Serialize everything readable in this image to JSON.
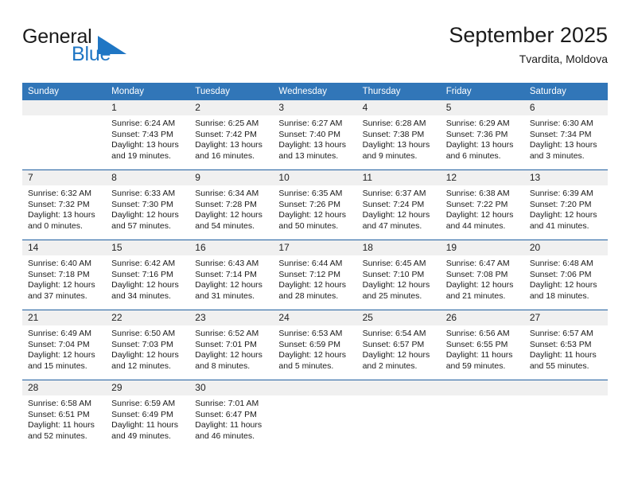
{
  "brand": {
    "name_part1": "General",
    "name_part2": "Blue",
    "accent_color": "#1f76c4",
    "triangle_icon": "triangle-icon"
  },
  "header": {
    "title": "September 2025",
    "subtitle": "Tvardita, Moldova"
  },
  "calendar": {
    "header_bg": "#3176b8",
    "daynum_bg": "#f0f0f0",
    "separator_color": "#1f5fa0",
    "weekdays": [
      "Sunday",
      "Monday",
      "Tuesday",
      "Wednesday",
      "Thursday",
      "Friday",
      "Saturday"
    ],
    "weeks": [
      [
        {
          "day": "",
          "lines": []
        },
        {
          "day": "1",
          "lines": [
            "Sunrise: 6:24 AM",
            "Sunset: 7:43 PM",
            "Daylight: 13 hours",
            "and 19 minutes."
          ]
        },
        {
          "day": "2",
          "lines": [
            "Sunrise: 6:25 AM",
            "Sunset: 7:42 PM",
            "Daylight: 13 hours",
            "and 16 minutes."
          ]
        },
        {
          "day": "3",
          "lines": [
            "Sunrise: 6:27 AM",
            "Sunset: 7:40 PM",
            "Daylight: 13 hours",
            "and 13 minutes."
          ]
        },
        {
          "day": "4",
          "lines": [
            "Sunrise: 6:28 AM",
            "Sunset: 7:38 PM",
            "Daylight: 13 hours",
            "and 9 minutes."
          ]
        },
        {
          "day": "5",
          "lines": [
            "Sunrise: 6:29 AM",
            "Sunset: 7:36 PM",
            "Daylight: 13 hours",
            "and 6 minutes."
          ]
        },
        {
          "day": "6",
          "lines": [
            "Sunrise: 6:30 AM",
            "Sunset: 7:34 PM",
            "Daylight: 13 hours",
            "and 3 minutes."
          ]
        }
      ],
      [
        {
          "day": "7",
          "lines": [
            "Sunrise: 6:32 AM",
            "Sunset: 7:32 PM",
            "Daylight: 13 hours",
            "and 0 minutes."
          ]
        },
        {
          "day": "8",
          "lines": [
            "Sunrise: 6:33 AM",
            "Sunset: 7:30 PM",
            "Daylight: 12 hours",
            "and 57 minutes."
          ]
        },
        {
          "day": "9",
          "lines": [
            "Sunrise: 6:34 AM",
            "Sunset: 7:28 PM",
            "Daylight: 12 hours",
            "and 54 minutes."
          ]
        },
        {
          "day": "10",
          "lines": [
            "Sunrise: 6:35 AM",
            "Sunset: 7:26 PM",
            "Daylight: 12 hours",
            "and 50 minutes."
          ]
        },
        {
          "day": "11",
          "lines": [
            "Sunrise: 6:37 AM",
            "Sunset: 7:24 PM",
            "Daylight: 12 hours",
            "and 47 minutes."
          ]
        },
        {
          "day": "12",
          "lines": [
            "Sunrise: 6:38 AM",
            "Sunset: 7:22 PM",
            "Daylight: 12 hours",
            "and 44 minutes."
          ]
        },
        {
          "day": "13",
          "lines": [
            "Sunrise: 6:39 AM",
            "Sunset: 7:20 PM",
            "Daylight: 12 hours",
            "and 41 minutes."
          ]
        }
      ],
      [
        {
          "day": "14",
          "lines": [
            "Sunrise: 6:40 AM",
            "Sunset: 7:18 PM",
            "Daylight: 12 hours",
            "and 37 minutes."
          ]
        },
        {
          "day": "15",
          "lines": [
            "Sunrise: 6:42 AM",
            "Sunset: 7:16 PM",
            "Daylight: 12 hours",
            "and 34 minutes."
          ]
        },
        {
          "day": "16",
          "lines": [
            "Sunrise: 6:43 AM",
            "Sunset: 7:14 PM",
            "Daylight: 12 hours",
            "and 31 minutes."
          ]
        },
        {
          "day": "17",
          "lines": [
            "Sunrise: 6:44 AM",
            "Sunset: 7:12 PM",
            "Daylight: 12 hours",
            "and 28 minutes."
          ]
        },
        {
          "day": "18",
          "lines": [
            "Sunrise: 6:45 AM",
            "Sunset: 7:10 PM",
            "Daylight: 12 hours",
            "and 25 minutes."
          ]
        },
        {
          "day": "19",
          "lines": [
            "Sunrise: 6:47 AM",
            "Sunset: 7:08 PM",
            "Daylight: 12 hours",
            "and 21 minutes."
          ]
        },
        {
          "day": "20",
          "lines": [
            "Sunrise: 6:48 AM",
            "Sunset: 7:06 PM",
            "Daylight: 12 hours",
            "and 18 minutes."
          ]
        }
      ],
      [
        {
          "day": "21",
          "lines": [
            "Sunrise: 6:49 AM",
            "Sunset: 7:04 PM",
            "Daylight: 12 hours",
            "and 15 minutes."
          ]
        },
        {
          "day": "22",
          "lines": [
            "Sunrise: 6:50 AM",
            "Sunset: 7:03 PM",
            "Daylight: 12 hours",
            "and 12 minutes."
          ]
        },
        {
          "day": "23",
          "lines": [
            "Sunrise: 6:52 AM",
            "Sunset: 7:01 PM",
            "Daylight: 12 hours",
            "and 8 minutes."
          ]
        },
        {
          "day": "24",
          "lines": [
            "Sunrise: 6:53 AM",
            "Sunset: 6:59 PM",
            "Daylight: 12 hours",
            "and 5 minutes."
          ]
        },
        {
          "day": "25",
          "lines": [
            "Sunrise: 6:54 AM",
            "Sunset: 6:57 PM",
            "Daylight: 12 hours",
            "and 2 minutes."
          ]
        },
        {
          "day": "26",
          "lines": [
            "Sunrise: 6:56 AM",
            "Sunset: 6:55 PM",
            "Daylight: 11 hours",
            "and 59 minutes."
          ]
        },
        {
          "day": "27",
          "lines": [
            "Sunrise: 6:57 AM",
            "Sunset: 6:53 PM",
            "Daylight: 11 hours",
            "and 55 minutes."
          ]
        }
      ],
      [
        {
          "day": "28",
          "lines": [
            "Sunrise: 6:58 AM",
            "Sunset: 6:51 PM",
            "Daylight: 11 hours",
            "and 52 minutes."
          ]
        },
        {
          "day": "29",
          "lines": [
            "Sunrise: 6:59 AM",
            "Sunset: 6:49 PM",
            "Daylight: 11 hours",
            "and 49 minutes."
          ]
        },
        {
          "day": "30",
          "lines": [
            "Sunrise: 7:01 AM",
            "Sunset: 6:47 PM",
            "Daylight: 11 hours",
            "and 46 minutes."
          ]
        },
        {
          "day": "",
          "lines": []
        },
        {
          "day": "",
          "lines": []
        },
        {
          "day": "",
          "lines": []
        },
        {
          "day": "",
          "lines": []
        }
      ]
    ]
  }
}
